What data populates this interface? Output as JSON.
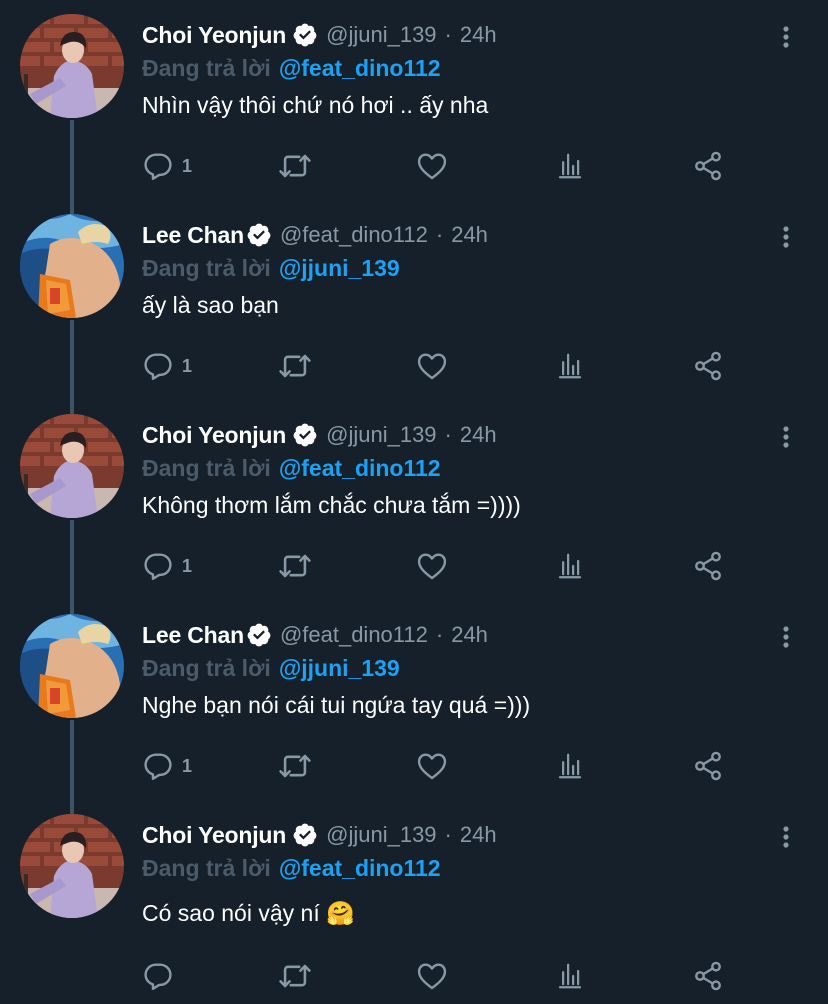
{
  "colors": {
    "background": "#15202b",
    "text_primary": "#ffffff",
    "text_secondary": "#8899a6",
    "link": "#1da1f2",
    "thread_line": "#3d5466"
  },
  "icons": {
    "reply": "speech-bubble-icon",
    "retweet": "retweet-icon",
    "like": "heart-icon",
    "analytics": "bar-chart-icon",
    "share": "share-icon",
    "verified": "verified-badge-icon",
    "more": "vertical-ellipsis-icon"
  },
  "tweets": [
    {
      "name": "Choi Yeonjun",
      "handle": "@jjuni_139",
      "separator": "·",
      "time": "24h",
      "reply_prefix": "Đang trả lời",
      "reply_to": "@feat_dino112",
      "text": "Nhìn vậy thôi chứ nó hơi .. ấy nha",
      "reply_count": "1"
    },
    {
      "name": "Lee Chan",
      "handle": "@feat_dino112",
      "separator": "·",
      "time": "24h",
      "reply_prefix": "Đang trả lời",
      "reply_to": "@jjuni_139",
      "text": "ấy là sao bạn",
      "reply_count": "1"
    },
    {
      "name": "Choi Yeonjun",
      "handle": "@jjuni_139",
      "separator": "·",
      "time": "24h",
      "reply_prefix": "Đang trả lời",
      "reply_to": "@feat_dino112",
      "text": "Không thơm lắm chắc chưa tắm =))))",
      "reply_count": "1"
    },
    {
      "name": "Lee Chan",
      "handle": "@feat_dino112",
      "separator": "·",
      "time": "24h",
      "reply_prefix": "Đang trả lời",
      "reply_to": "@jjuni_139",
      "text": "Nghe bạn nói cái tui ngứa tay quá =)))",
      "reply_count": "1"
    },
    {
      "name": "Choi Yeonjun",
      "handle": "@jjuni_139",
      "separator": "·",
      "time": "24h",
      "reply_prefix": "Đang trả lời",
      "reply_to": "@feat_dino112",
      "text": "Có sao nói vậy ní 🤗",
      "reply_count": ""
    }
  ]
}
